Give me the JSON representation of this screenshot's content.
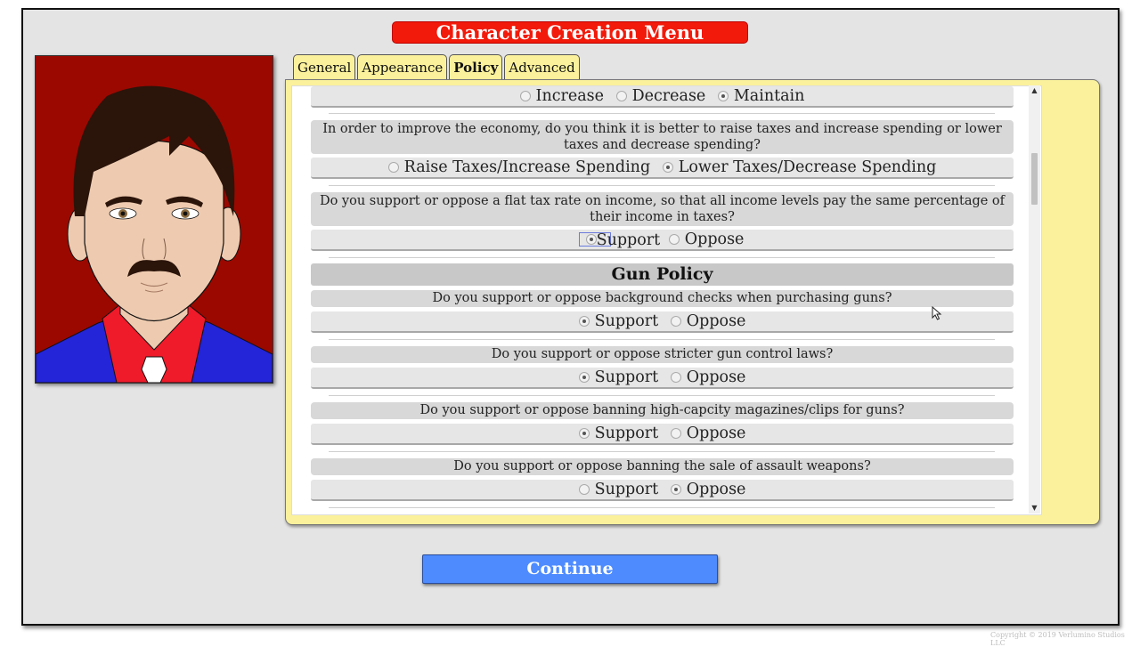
{
  "header": {
    "title": "Character Creation Menu"
  },
  "tabs": [
    {
      "label": "General",
      "active": false
    },
    {
      "label": "Appearance",
      "active": false
    },
    {
      "label": "Policy",
      "active": true
    },
    {
      "label": "Advanced",
      "active": false
    }
  ],
  "policy": {
    "partial_top": {
      "options": [
        "Increase",
        "Decrease",
        "Maintain"
      ],
      "selected": "Maintain"
    },
    "questions_economy": [
      {
        "text": "In order to improve the economy, do you think it is better to raise taxes and increase spending or lower taxes and decrease spending?",
        "options": [
          "Raise Taxes/Increase Spending",
          "Lower Taxes/Decrease Spending"
        ],
        "selected": "Lower Taxes/Decrease Spending"
      },
      {
        "text": "Do you support or oppose a flat tax rate on income, so that all income levels pay the same percentage of their income in taxes?",
        "options": [
          "Support",
          "Oppose"
        ],
        "selected": "Support"
      }
    ],
    "gun_section": {
      "title": "Gun Policy",
      "questions": [
        {
          "text": "Do you support or oppose background checks when purchasing guns?",
          "options": [
            "Support",
            "Oppose"
          ],
          "selected": "Support"
        },
        {
          "text": "Do you support or oppose stricter gun control laws?",
          "options": [
            "Support",
            "Oppose"
          ],
          "selected": "Support"
        },
        {
          "text": "Do you support or oppose banning high-capcity magazines/clips for guns?",
          "options": [
            "Support",
            "Oppose"
          ],
          "selected": "Support"
        },
        {
          "text": "Do you support or oppose banning the sale of assault weapons?",
          "options": [
            "Support",
            "Oppose"
          ],
          "selected": "Oppose"
        }
      ]
    }
  },
  "scrollbar": {
    "up_icon": "▲",
    "down_icon": "▼"
  },
  "footer": {
    "continue_label": "Continue",
    "copyright": "Copyright © 2019 Verlumino Studios LLC"
  },
  "portrait": {
    "background_color": "#9b0800",
    "hair_color": "#2b140a",
    "skin_color": "#eecbb0",
    "suit_color": "#2424d8",
    "shirt_color": "#ef1a2a",
    "tie_color": "#ffffff"
  }
}
